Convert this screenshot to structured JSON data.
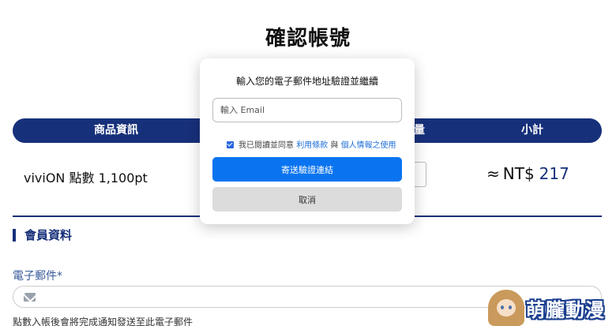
{
  "page": {
    "title": "確認帳號"
  },
  "table": {
    "headers": {
      "product": "商品資訊",
      "quantity": "量",
      "subtotal": "小計"
    },
    "row": {
      "product_name": "viviON 點數 1,100pt",
      "approx_symbol": "≈",
      "currency": "NT$",
      "amount": "217"
    }
  },
  "member": {
    "section_title": "會員資料",
    "email_label": "電子郵件*",
    "email_hint": "點數入帳後會將完成通知發送至此電子郵件"
  },
  "modal": {
    "title": "輸入您的電子郵件地址驗證並繼續",
    "email_placeholder": "輸入 Email",
    "agree_prefix": "我已閱讀並同意",
    "terms_link": "利用條款",
    "agree_and": "與",
    "privacy_link": "個人情報之使用",
    "agree_checked": true,
    "send_button": "寄送驗證連結",
    "cancel_button": "取消"
  },
  "watermark": {
    "text": "萌朧動漫"
  },
  "colors": {
    "brand_navy": "#17307a",
    "primary_button": "#0a74f0",
    "link": "#1e6fd9",
    "cancel_button": "#dcdcdc"
  },
  "icons": {
    "email_field": "envelope-icon",
    "agree": "checkbox-checked-icon"
  }
}
